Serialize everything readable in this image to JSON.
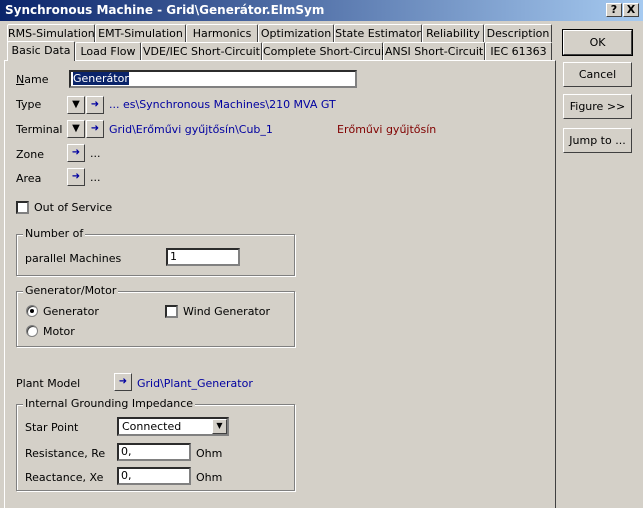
{
  "window": {
    "title": "Synchronous Machine - Grid\\Generátor.ElmSym",
    "help_btn": "?",
    "close_btn": "X"
  },
  "tabs_row1": [
    "RMS-Simulation",
    "EMT-Simulation",
    "Harmonics",
    "Optimization",
    "State Estimator",
    "Reliability",
    "Description"
  ],
  "tabs_row2": [
    "Basic Data",
    "Load Flow",
    "VDE/IEC Short-Circuit",
    "Complete Short-Circuit",
    "ANSI Short-Circuit",
    "IEC 61363"
  ],
  "form": {
    "name_label": "Name",
    "name_value": "Generátor",
    "type_label": "Type",
    "type_value": "... es\\Synchronous Machines\\210 MVA GT",
    "terminal_label": "Terminal",
    "terminal_value": "Grid\\Erőművi gyűjtősín\\Cub_1",
    "terminal_extra": "Erőművi gyűjtősín",
    "zone_label": "Zone",
    "zone_value": "...",
    "area_label": "Area",
    "area_value": "...",
    "out_of_service_label": "Out of Service",
    "number_of_title": "Number of",
    "parallel_label": "parallel Machines",
    "parallel_value": "1",
    "genmotor_title": "Generator/Motor",
    "generator_label": "Generator",
    "motor_label": "Motor",
    "wind_label": "Wind Generator",
    "plant_model_label": "Plant Model",
    "plant_model_value": "Grid\\Plant_Generator",
    "grounding_title": "Internal Grounding Impedance",
    "star_point_label": "Star Point",
    "star_point_value": "Connected",
    "resistance_label": "Resistance, Re",
    "resistance_value": "0,",
    "resistance_unit": "Ohm",
    "reactance_label": "Reactance, Xe",
    "reactance_value": "0,",
    "reactance_unit": "Ohm"
  },
  "buttons": {
    "ok": "OK",
    "cancel": "Cancel",
    "figure": "Figure >>",
    "jump": "Jump to ..."
  }
}
